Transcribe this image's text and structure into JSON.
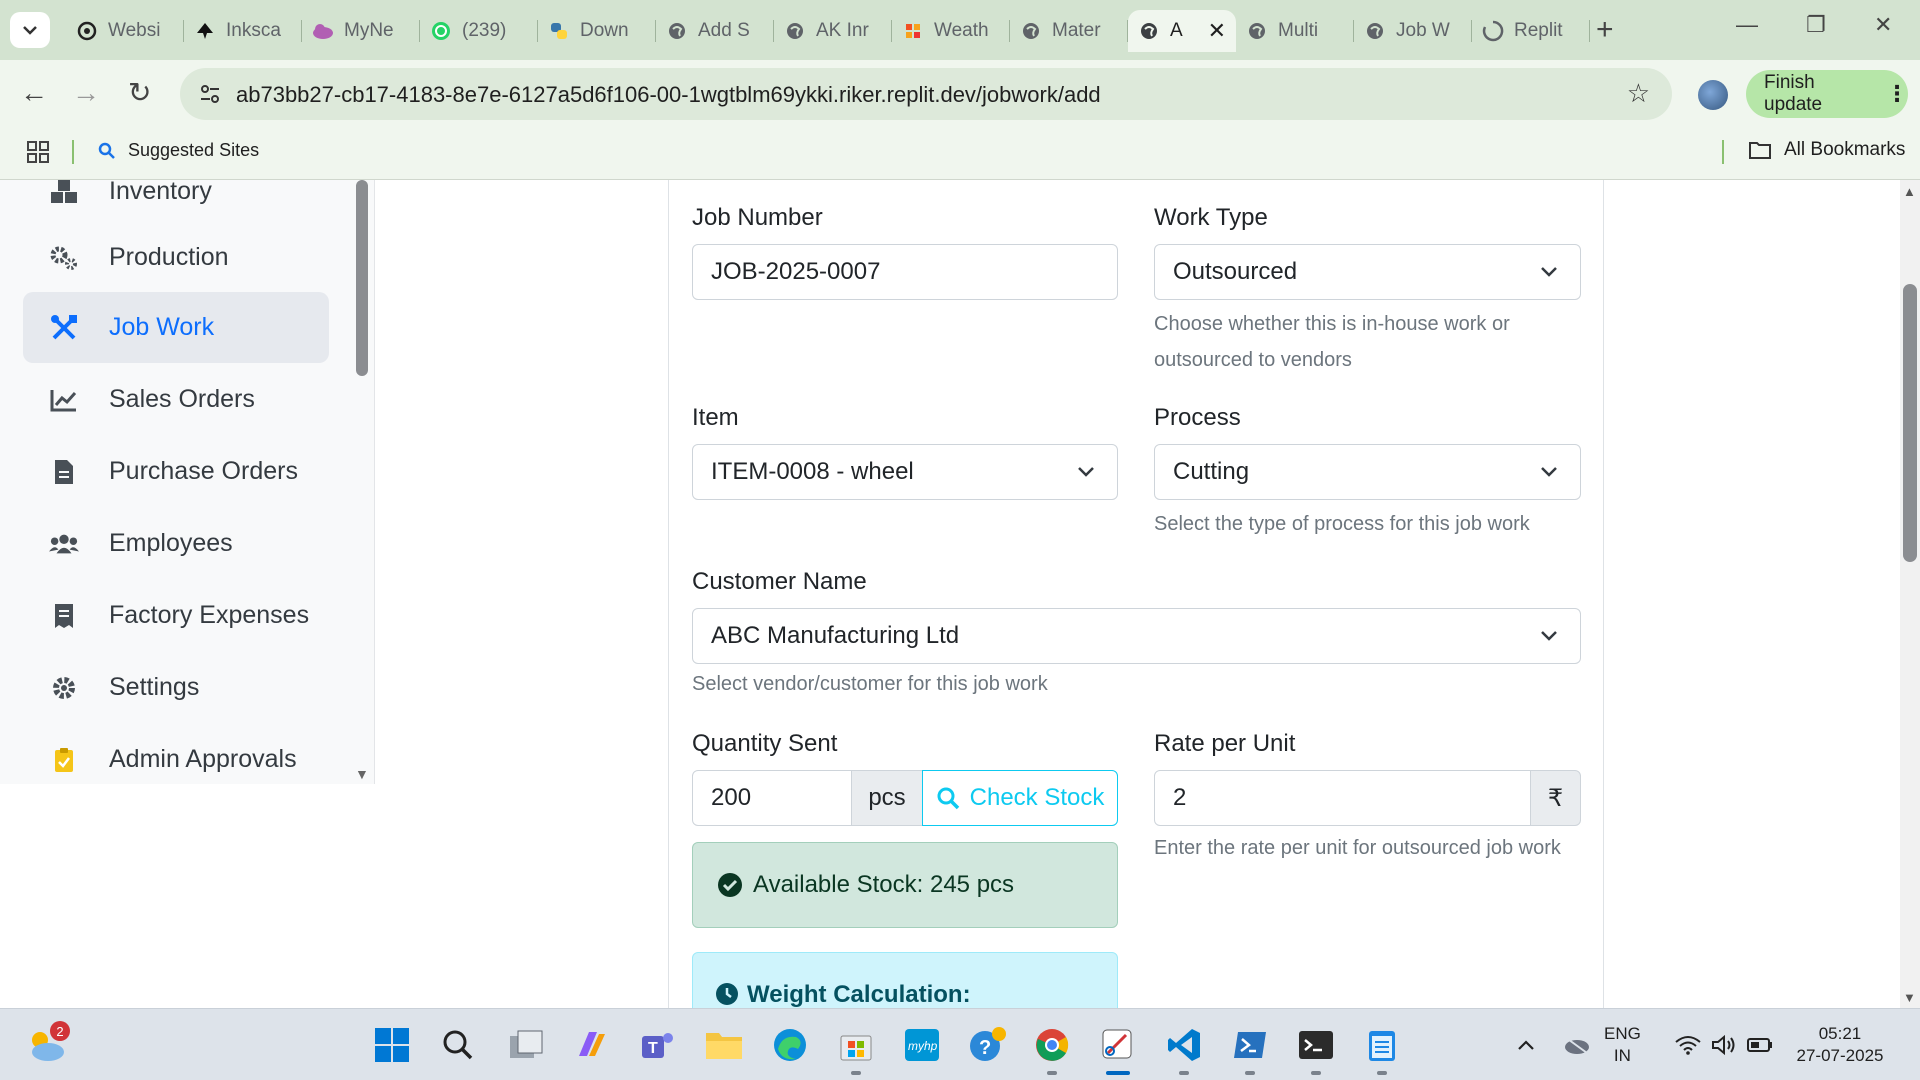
{
  "browser": {
    "tabs": [
      {
        "title": "Websi",
        "icon": "openai-icon"
      },
      {
        "title": "Inksca",
        "icon": "inkscape-icon"
      },
      {
        "title": "MyNe",
        "icon": "cloud-icon"
      },
      {
        "title": "(239) ",
        "icon": "whatsapp-icon"
      },
      {
        "title": "Down",
        "icon": "python-icon"
      },
      {
        "title": "Add S",
        "icon": "globe-icon"
      },
      {
        "title": "AK Inr",
        "icon": "globe-icon"
      },
      {
        "title": "Weath",
        "icon": "weather-icon"
      },
      {
        "title": "Mater",
        "icon": "globe-icon"
      },
      {
        "title": "A",
        "icon": "globe-icon",
        "active": true
      },
      {
        "title": "Multi",
        "icon": "globe-icon"
      },
      {
        "title": "Job W",
        "icon": "globe-icon"
      },
      {
        "title": "Replit",
        "icon": "loading-icon"
      }
    ],
    "url": "ab73bb27-cb17-4183-8e7e-6127a5d6f106-00-1wgtblm69ykki.riker.replit.dev/jobwork/add",
    "finish_update": "Finish update",
    "bookmarks": {
      "suggested": "Suggested Sites",
      "all": "All Bookmarks"
    }
  },
  "sidebar": {
    "items": [
      {
        "label": "Inventory",
        "icon": "boxes-icon"
      },
      {
        "label": "Production",
        "icon": "cogs-icon"
      },
      {
        "label": "Job Work",
        "icon": "tools-icon",
        "active": true
      },
      {
        "label": "Sales Orders",
        "icon": "chart-line-icon"
      },
      {
        "label": "Purchase Orders",
        "icon": "file-invoice-icon"
      },
      {
        "label": "Employees",
        "icon": "users-icon"
      },
      {
        "label": "Factory Expenses",
        "icon": "receipt-icon"
      },
      {
        "label": "Settings",
        "icon": "gear-icon"
      },
      {
        "label": "Admin Approvals",
        "icon": "clipboard-check-icon"
      }
    ]
  },
  "form": {
    "job_number": {
      "label": "Job Number",
      "value": "JOB-2025-0007"
    },
    "work_type": {
      "label": "Work Type",
      "value": "Outsourced",
      "help": "Choose whether this is in-house work or outsourced to vendors"
    },
    "item": {
      "label": "Item",
      "value": "ITEM-0008 - wheel"
    },
    "process": {
      "label": "Process",
      "value": "Cutting",
      "help": "Select the type of process for this job work"
    },
    "customer": {
      "label": "Customer Name",
      "value": "ABC Manufacturing Ltd",
      "help": "Select vendor/customer for this job work"
    },
    "quantity": {
      "label": "Quantity Sent",
      "value": "200",
      "unit": "pcs",
      "check_stock": "Check Stock"
    },
    "rate": {
      "label": "Rate per Unit",
      "value": "2",
      "currency": "₹",
      "help": "Enter the rate per unit for outsourced job work"
    },
    "stock_alert": "Available Stock: 245 pcs",
    "weight_title": "Weight Calculation:"
  },
  "taskbar": {
    "weather_badge": "2",
    "lang_top": "ENG",
    "lang_bottom": "IN",
    "time": "05:21",
    "date": "27-07-2025"
  },
  "colors": {
    "accent": "#0d6efd",
    "info": "#0dcaf0",
    "success_bg": "#d1e7dd",
    "chrome_frame": "#d3e3d0"
  }
}
